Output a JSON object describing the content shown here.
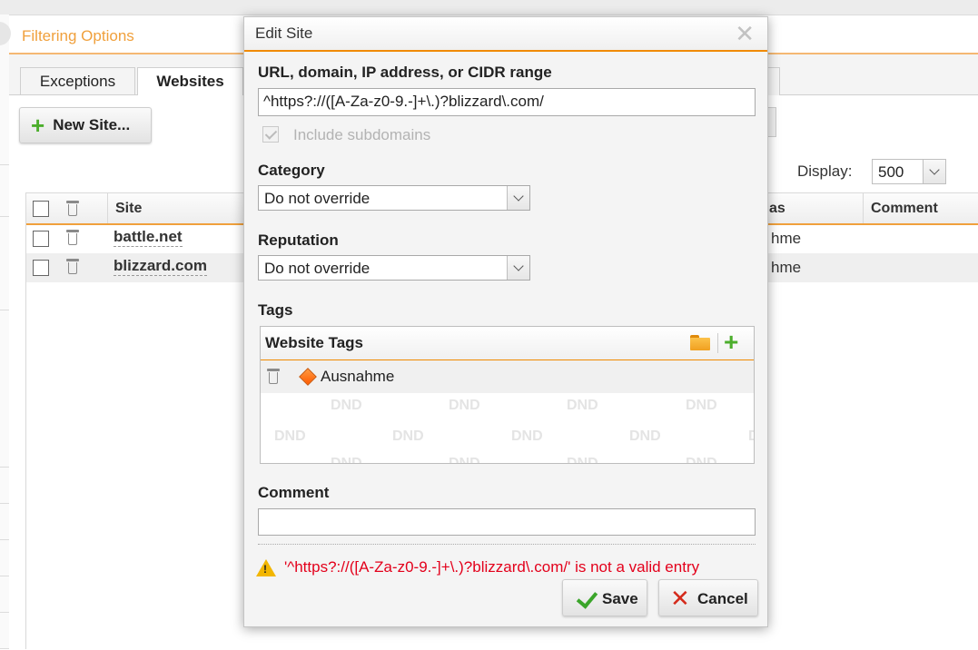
{
  "panel": {
    "title": "Filtering Options"
  },
  "tabs": [
    {
      "label": "Exceptions",
      "active": false
    },
    {
      "label": "Websites",
      "active": true
    }
  ],
  "toolbar": {
    "new_site_label": "New Site..."
  },
  "display": {
    "label": "Display:",
    "value": "500"
  },
  "grid": {
    "columns": {
      "site": "Site",
      "tags": "as",
      "comment": "Comment"
    },
    "rows": [
      {
        "site": "battle.net",
        "tags": "hme"
      },
      {
        "site": "blizzard.com",
        "tags": "hme"
      }
    ]
  },
  "dialog": {
    "title": "Edit Site",
    "close_icon": "close-icon",
    "url_label": "URL, domain, IP address, or CIDR range",
    "url_value": "^https?://([A-Za-z0-9.-]+\\.)?blizzard\\.com/",
    "include_subdomains_label": "Include subdomains",
    "include_subdomains_checked": true,
    "category_label": "Category",
    "category_value": "Do not override",
    "reputation_label": "Reputation",
    "reputation_value": "Do not override",
    "tags_label": "Tags",
    "tags_box_title": "Website Tags",
    "tags": [
      "Ausnahme"
    ],
    "dnd_text": "DND",
    "comment_label": "Comment",
    "comment_value": "",
    "error_text": "'^https?://([A-Za-z0-9.-]+\\.)?blizzard\\.com/' is not a valid entry",
    "save_label": "Save",
    "cancel_label": "Cancel"
  },
  "colors": {
    "accent": "#f08a00",
    "error": "#e3001b",
    "add_green": "#4cae2c"
  }
}
